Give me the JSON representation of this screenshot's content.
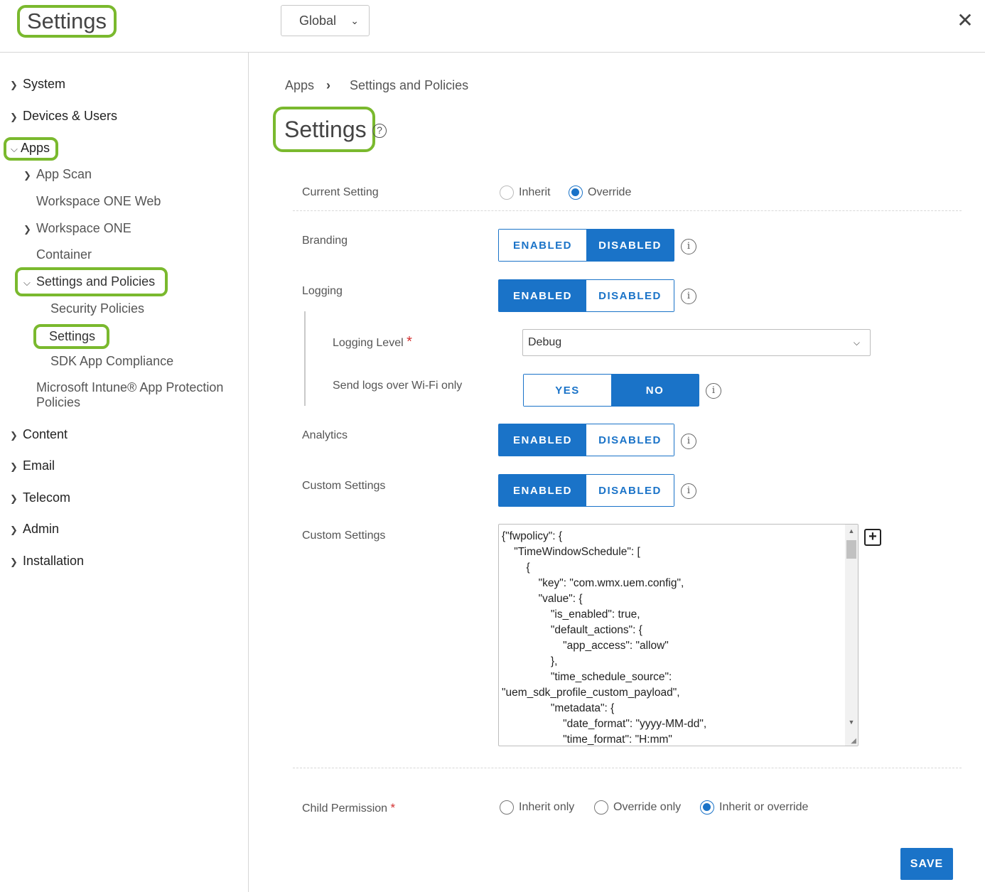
{
  "header": {
    "title": "Settings",
    "scope_value": "Global",
    "close_glyph": "✕"
  },
  "sidebar": {
    "items": [
      {
        "label": "System"
      },
      {
        "label": "Devices & Users"
      },
      {
        "label": "Apps"
      },
      {
        "label": "App Scan"
      },
      {
        "label": "Workspace ONE Web"
      },
      {
        "label": "Workspace ONE"
      },
      {
        "label": "Container"
      },
      {
        "label": "Settings and Policies"
      },
      {
        "label": "Security Policies"
      },
      {
        "label": "Settings"
      },
      {
        "label": "SDK App Compliance"
      },
      {
        "label": "Microsoft Intune® App Protection"
      },
      {
        "label": "Policies"
      },
      {
        "label": "Content"
      },
      {
        "label": "Email"
      },
      {
        "label": "Telecom"
      },
      {
        "label": "Admin"
      },
      {
        "label": "Installation"
      }
    ]
  },
  "breadcrumb": {
    "items": [
      "Apps",
      "Settings and Policies"
    ],
    "separator": "›"
  },
  "page": {
    "title": "Settings",
    "help_glyph": "?"
  },
  "form": {
    "current_setting": {
      "label": "Current Setting",
      "options": [
        "Inherit",
        "Override"
      ],
      "selected": "Override"
    },
    "branding": {
      "label": "Branding",
      "options": [
        "ENABLED",
        "DISABLED"
      ],
      "selected": "DISABLED"
    },
    "logging": {
      "label": "Logging",
      "options": [
        "ENABLED",
        "DISABLED"
      ],
      "selected": "ENABLED"
    },
    "logging_level": {
      "label": "Logging Level",
      "required_mark": "*",
      "value": "Debug"
    },
    "wifi_only": {
      "label": "Send logs over Wi-Fi only",
      "options": [
        "YES",
        "NO"
      ],
      "selected": "NO"
    },
    "analytics": {
      "label": "Analytics",
      "options": [
        "ENABLED",
        "DISABLED"
      ],
      "selected": "ENABLED"
    },
    "custom_settings_toggle": {
      "label": "Custom Settings",
      "options": [
        "ENABLED",
        "DISABLED"
      ],
      "selected": "ENABLED"
    },
    "custom_settings_text": {
      "label": "Custom Settings",
      "value": "{\"fwpolicy\": {\n    \"TimeWindowSchedule\": [\n        {\n            \"key\": \"com.wmx.uem.config\",\n            \"value\": {\n                \"is_enabled\": true,\n                \"default_actions\": {\n                    \"app_access\": \"allow\"\n                },\n                \"time_schedule_source\":\n\"uem_sdk_profile_custom_payload\",\n                \"metadata\": {\n                    \"date_format\": \"yyyy-MM-dd\",\n                    \"time_format\": \"H:mm\""
    },
    "child_permission": {
      "label": "Child Permission",
      "required_mark": "*",
      "options": [
        "Inherit only",
        "Override only",
        "Inherit or override"
      ],
      "selected": "Inherit or override"
    },
    "info_glyph": "i",
    "add_glyph": "+"
  },
  "actions": {
    "save_label": "SAVE"
  },
  "colors": {
    "accent": "#1a73c8",
    "highlight": "#7ab92e",
    "required": "#d32f2f"
  }
}
